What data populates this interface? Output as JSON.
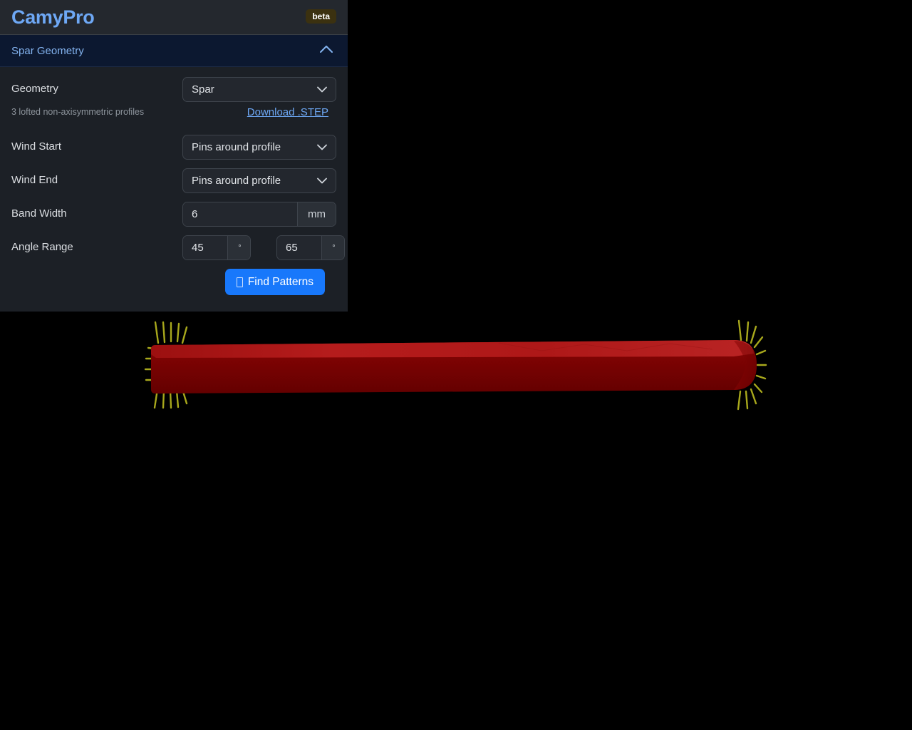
{
  "app": {
    "brand": "CamyPro",
    "badge": "beta"
  },
  "section": {
    "title": "Spar Geometry",
    "collapse_icon": "chevron-up-icon"
  },
  "form": {
    "geometry": {
      "label": "Geometry",
      "value": "Spar",
      "hint": "3 lofted non-axisymmetric profiles",
      "download_link": "Download .STEP"
    },
    "wind_start": {
      "label": "Wind Start",
      "value": "Pins around profile"
    },
    "wind_end": {
      "label": "Wind End",
      "value": "Pins around profile"
    },
    "band_width": {
      "label": "Band Width",
      "value": "6",
      "unit": "mm"
    },
    "angle_range": {
      "label": "Angle Range",
      "min_value": "45",
      "max_value": "65",
      "unit": "°"
    },
    "submit": {
      "label": "Find Patterns"
    }
  },
  "colors": {
    "accent_blue": "#1878fb",
    "brand_blue": "#6ea8f5",
    "panel_bg": "#1c2026",
    "section_bg": "#0c1830",
    "badge_bg": "#3b3110",
    "viewport_bg": "#000000",
    "model_body": "#7a0404",
    "model_top": "#b01a1a",
    "pin_color": "#a8a81c"
  }
}
